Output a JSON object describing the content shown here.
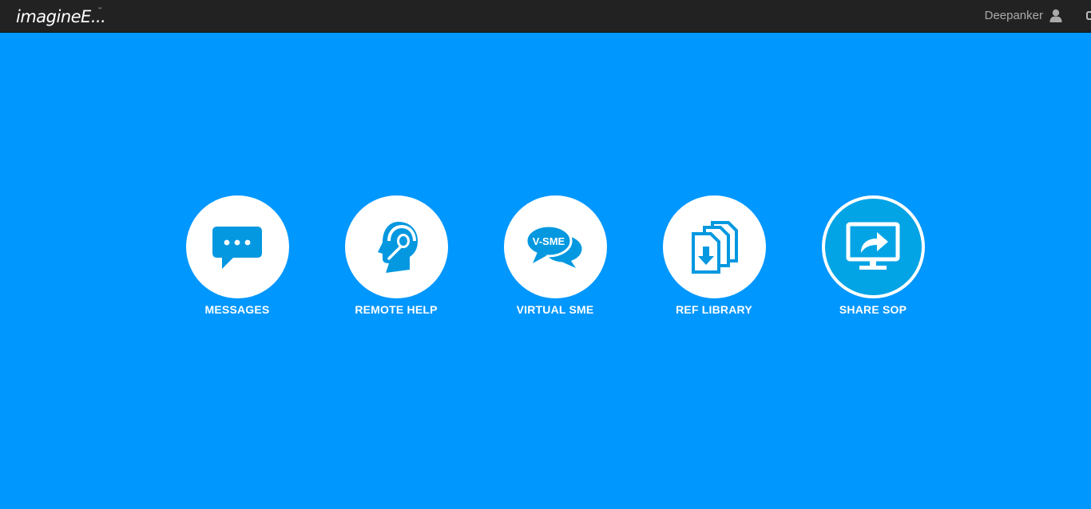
{
  "header": {
    "logo_text": "imagineE...",
    "logo_tm": "™",
    "user_name": "Deepanker",
    "user_icon": "user-icon"
  },
  "tiles": [
    {
      "label": "MESSAGES",
      "icon": "chat-bubble-icon",
      "active": false
    },
    {
      "label": "REMOTE HELP",
      "icon": "headset-icon",
      "active": false
    },
    {
      "label": "VIRTUAL SME",
      "icon": "chat-bubbles-icon",
      "badge": "V-SME",
      "active": false
    },
    {
      "label": "REF LIBRARY",
      "icon": "documents-download-icon",
      "active": false
    },
    {
      "label": "SHARE SOP",
      "icon": "monitor-share-icon",
      "active": true
    }
  ],
  "colors": {
    "background": "#0097fe",
    "topbar": "#222222",
    "icon_blue": "#0398e0",
    "active_circle": "#03a4e6"
  }
}
